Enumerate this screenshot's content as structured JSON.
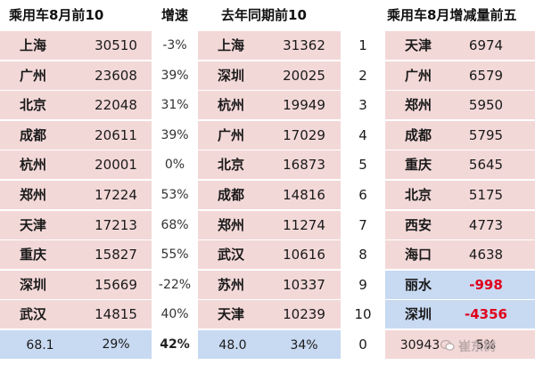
{
  "headers": {
    "top10_aug": "乘用车8月前10",
    "growth": "增速",
    "last_year_top10": "去年同期前10",
    "increase_top5": "乘用车8月增减量前五"
  },
  "rows": [
    {
      "city": "上海",
      "sales": "30510",
      "growth": "-3%",
      "ly_city": "上海",
      "ly_sales": "31362",
      "rank": "1",
      "inc_city": "天津",
      "inc_value": "6974",
      "negative": false
    },
    {
      "city": "广州",
      "sales": "23608",
      "growth": "39%",
      "ly_city": "深圳",
      "ly_sales": "20025",
      "rank": "2",
      "inc_city": "广州",
      "inc_value": "6579",
      "negative": false
    },
    {
      "city": "北京",
      "sales": "22048",
      "growth": "31%",
      "ly_city": "杭州",
      "ly_sales": "19949",
      "rank": "3",
      "inc_city": "郑州",
      "inc_value": "5950",
      "negative": false
    },
    {
      "city": "成都",
      "sales": "20611",
      "growth": "39%",
      "ly_city": "广州",
      "ly_sales": "17029",
      "rank": "4",
      "inc_city": "成都",
      "inc_value": "5795",
      "negative": false
    },
    {
      "city": "杭州",
      "sales": "20001",
      "growth": "0%",
      "ly_city": "北京",
      "ly_sales": "16873",
      "rank": "5",
      "inc_city": "重庆",
      "inc_value": "5645",
      "negative": false
    },
    {
      "city": "郑州",
      "sales": "17224",
      "growth": "53%",
      "ly_city": "成都",
      "ly_sales": "14816",
      "rank": "6",
      "inc_city": "北京",
      "inc_value": "5175",
      "negative": false
    },
    {
      "city": "天津",
      "sales": "17213",
      "growth": "68%",
      "ly_city": "郑州",
      "ly_sales": "11274",
      "rank": "7",
      "inc_city": "西安",
      "inc_value": "4773",
      "negative": false
    },
    {
      "city": "重庆",
      "sales": "15827",
      "growth": "55%",
      "ly_city": "武汉",
      "ly_sales": "10616",
      "rank": "8",
      "inc_city": "海口",
      "inc_value": "4638",
      "negative": false
    },
    {
      "city": "深圳",
      "sales": "15669",
      "growth": "-22%",
      "ly_city": "苏州",
      "ly_sales": "10337",
      "rank": "9",
      "inc_city": "丽水",
      "inc_value": "-998",
      "negative": true
    },
    {
      "city": "武汉",
      "sales": "14815",
      "growth": "40%",
      "ly_city": "天津",
      "ly_sales": "10239",
      "rank": "10",
      "inc_city": "深圳",
      "inc_value": "-4356",
      "negative": true
    }
  ],
  "footer": {
    "total_a": "68.1",
    "share_a": "29%",
    "growth_total": "42%",
    "total_b": "48.0",
    "share_b": "34%",
    "rank": "0",
    "total_c": "30943",
    "share_c": "5%"
  },
  "watermark": "崔东树",
  "colors": {
    "pink": "#f3d8d8",
    "blue": "#c8d9f2",
    "negative": "#e0001c"
  }
}
